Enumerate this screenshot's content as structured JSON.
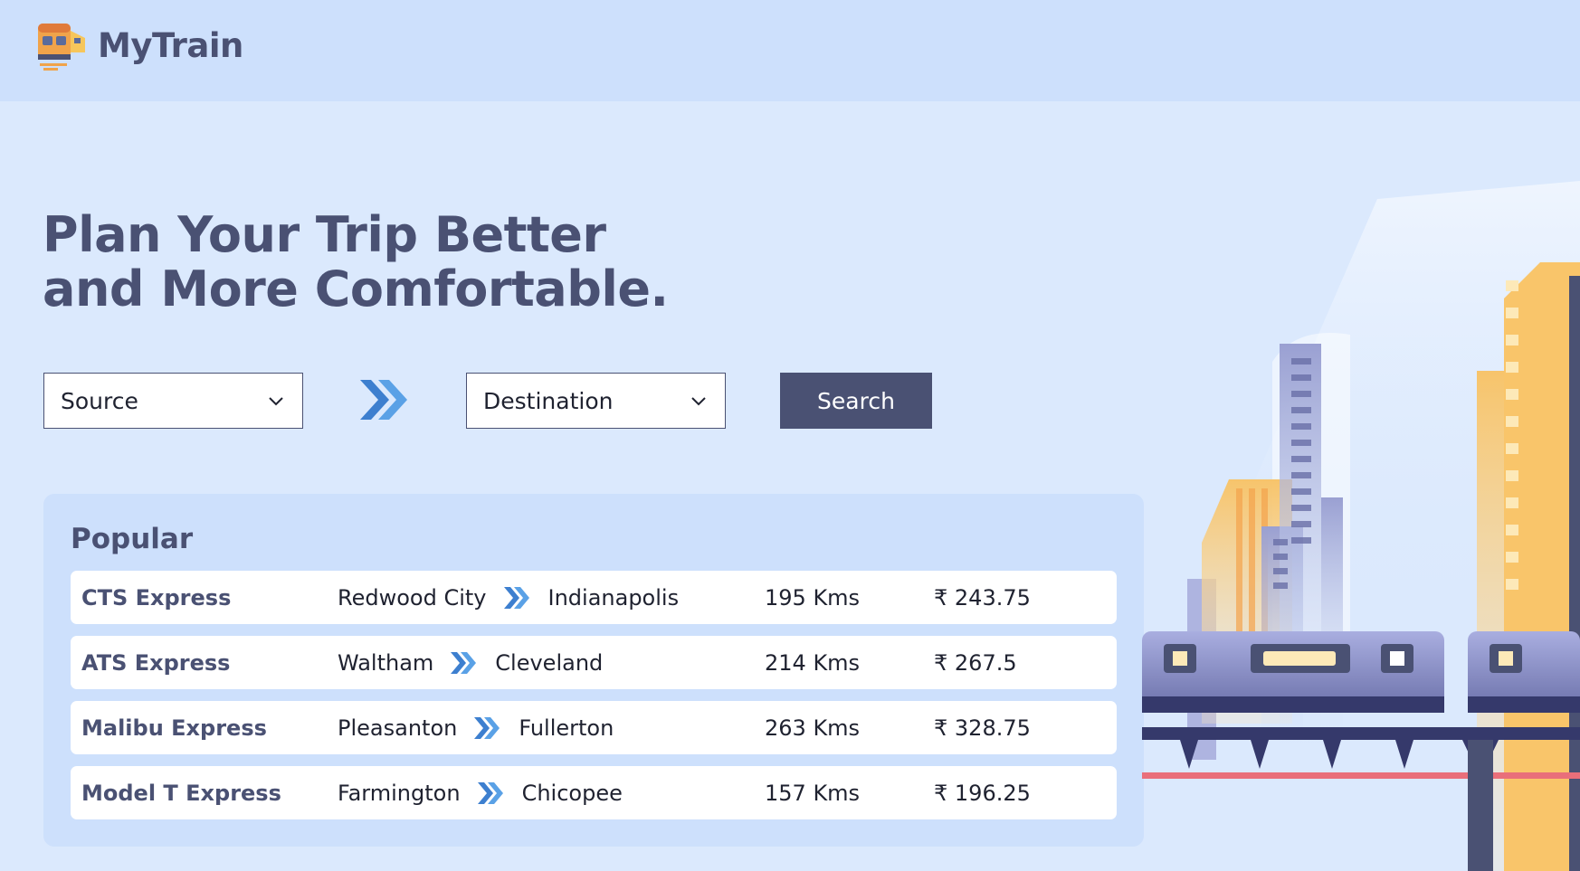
{
  "brand": {
    "name": "MyTrain",
    "logo_icon": "train-logo-icon"
  },
  "hero": {
    "line1": "Plan Your Trip Better",
    "line2": "and More Comfortable."
  },
  "search": {
    "source_label": "Source",
    "destination_label": "Destination",
    "button_label": "Search"
  },
  "popular": {
    "heading": "Popular",
    "rows": [
      {
        "train": "CTS Express",
        "from": "Redwood City",
        "to": "Indianapolis",
        "distance": "195 Kms",
        "fare": "₹ 243.75"
      },
      {
        "train": "ATS Express",
        "from": "Waltham",
        "to": "Cleveland",
        "distance": "214 Kms",
        "fare": "₹ 267.5"
      },
      {
        "train": "Malibu Express",
        "from": "Pleasanton",
        "to": "Fullerton",
        "distance": "263 Kms",
        "fare": "₹ 328.75"
      },
      {
        "train": "Model T Express",
        "from": "Farmington",
        "to": "Chicopee",
        "distance": "157 Kms",
        "fare": "₹ 196.25"
      }
    ]
  },
  "colors": {
    "accent": "#4a5173",
    "arrow": "#4a90d9",
    "page_bg": "#dbe9fd",
    "header_bg": "#cde0fc"
  }
}
